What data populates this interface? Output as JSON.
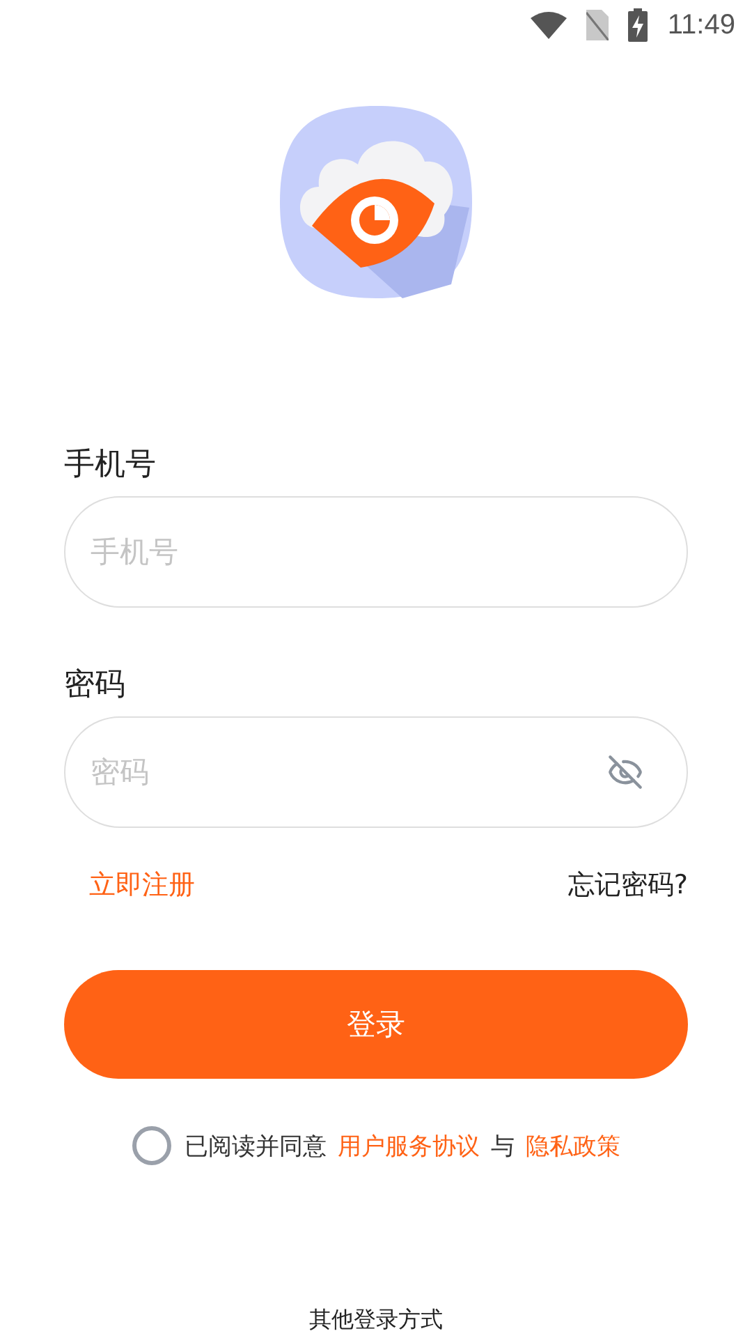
{
  "status_bar": {
    "time": "11:49"
  },
  "fields": [
    {
      "label": "手机号",
      "placeholder": "手机号",
      "kind": "text"
    },
    {
      "label": "密码",
      "placeholder": "密码",
      "kind": "password",
      "visible": false
    }
  ],
  "register_link": "立即注册",
  "forgot_link": "忘记密码?",
  "login_button": "登录",
  "agreement": {
    "checked": false,
    "prefix": "已阅读并同意",
    "terms": "用户服务协议",
    "joiner": "与",
    "privacy": "隐私政策"
  },
  "other_login": "其他登录方式"
}
